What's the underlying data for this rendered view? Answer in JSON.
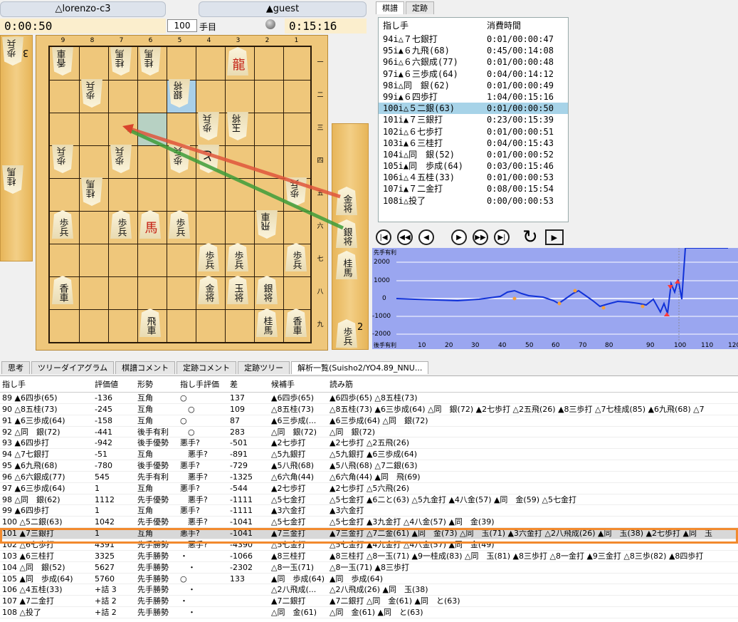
{
  "players": {
    "gote_name": "△lorenzo-c3",
    "sente_name": "▲guest",
    "gote_time": "0:00:50",
    "sente_time": "0:15:16",
    "move_number": "100",
    "move_unit": "手目"
  },
  "board": {
    "col_labels": [
      "9",
      "8",
      "7",
      "6",
      "5",
      "4",
      "3",
      "2",
      "1"
    ],
    "row_labels": [
      "一",
      "二",
      "三",
      "四",
      "五",
      "六",
      "七",
      "八",
      "九"
    ],
    "gote_hand_count": "3",
    "sente_hand_count": "2",
    "pieces": [
      {
        "t": "香車",
        "g": true
      },
      {
        "t": "桂馬",
        "g": true
      },
      {
        "t": "桂馬",
        "g": true
      },
      {
        "t": "龍",
        "g": false,
        "p": true
      },
      {
        "t": "歩兵",
        "g": true
      },
      {
        "t": "銀将",
        "g": true
      },
      {
        "t": "歩兵",
        "g": true
      },
      {
        "t": "玉将",
        "g": true
      },
      {
        "t": "歩兵",
        "g": true
      },
      {
        "t": "歩兵",
        "g": true
      },
      {
        "t": "歩兵",
        "g": true
      },
      {
        "t": "と",
        "g": true
      },
      {
        "t": "桂馬",
        "g": true
      },
      {
        "t": "歩兵",
        "g": true
      },
      {
        "t": "歩兵",
        "g": false
      },
      {
        "t": "歩兵",
        "g": false
      },
      {
        "t": "馬",
        "g": false,
        "p": true
      },
      {
        "t": "歩兵",
        "g": false
      },
      {
        "t": "飛車",
        "g": true
      },
      {
        "t": "歩兵",
        "g": false
      },
      {
        "t": "歩兵",
        "g": false
      },
      {
        "t": "歩兵",
        "g": false
      },
      {
        "t": "香車",
        "g": false
      },
      {
        "t": "金将",
        "g": false
      },
      {
        "t": "玉将",
        "g": false
      },
      {
        "t": "銀将",
        "g": false
      },
      {
        "t": "飛車",
        "g": false
      },
      {
        "t": "桂馬",
        "g": false
      },
      {
        "t": "香車",
        "g": false
      }
    ],
    "gote_hand": [
      {
        "t": "歩兵"
      },
      {
        "t": "桂馬"
      }
    ],
    "sente_hand": [
      {
        "t": "金将"
      },
      {
        "t": "銀将"
      },
      {
        "t": "桂馬"
      },
      {
        "t": "歩兵"
      }
    ]
  },
  "kifu_tabs": [
    "棋譜",
    "定跡"
  ],
  "kifu_header": {
    "move": "指し手",
    "time": "消費時間"
  },
  "kifu": [
    {
      "m": "94i△７七銀打",
      "t": "0:01/00:00:47"
    },
    {
      "m": "95i▲６九飛(68)",
      "t": "0:45/00:14:08"
    },
    {
      "m": "96i△６六銀成(77)",
      "t": "0:01/00:00:48"
    },
    {
      "m": "97i▲６三歩成(64)",
      "t": "0:04/00:14:12"
    },
    {
      "m": "98i△同　銀(62)",
      "t": "0:01/00:00:49"
    },
    {
      "m": "99i▲６四歩打",
      "t": "1:04/00:15:16"
    },
    {
      "m": "100i△５二銀(63)",
      "t": "0:01/00:00:50"
    },
    {
      "m": "101i▲７三銀打",
      "t": "0:23/00:15:39"
    },
    {
      "m": "102i△６七歩打",
      "t": "0:01/00:00:51"
    },
    {
      "m": "103i▲６三桂打",
      "t": "0:04/00:15:43"
    },
    {
      "m": "104i△同　銀(52)",
      "t": "0:01/00:00:52"
    },
    {
      "m": "105i▲同　歩成(64)",
      "t": "0:03/00:15:46"
    },
    {
      "m": "106i△４五桂(33)",
      "t": "0:01/00:00:53"
    },
    {
      "m": "107i▲７二金打",
      "t": "0:08/00:15:54"
    },
    {
      "m": "108i△投了",
      "t": "0:00/00:00:53"
    }
  ],
  "graph": {
    "title": "先手有利",
    "bottom_label": "後手有利",
    "y_ticks": [
      "2000",
      "1000",
      "0",
      "-1000",
      "-2000"
    ],
    "x_ticks": [
      "10",
      "20",
      "30",
      "40",
      "50",
      "60",
      "70",
      "80",
      "90",
      "100",
      "110",
      "120"
    ]
  },
  "lower_tabs": [
    "思考",
    "ツリーダイアグラム",
    "棋譜コメント",
    "定跡コメント",
    "定跡ツリー",
    "解析一覧(Suisho2/YO4.89_NNU..."
  ],
  "analysis_header": [
    "指し手",
    "評価値",
    "形勢",
    "指し手評価",
    "差",
    "候補手",
    "読み筋"
  ],
  "analysis": [
    [
      "89 ▲6四歩(65)",
      "-136",
      "互角",
      "○",
      "137",
      "▲6四歩(65)",
      "▲6四歩(65) △8五桂(73)"
    ],
    [
      "90 △8五桂(73)",
      "-245",
      "互角",
      "　○",
      "109",
      "△8五桂(73)",
      "△8五桂(73) ▲6三歩成(64) △同　銀(72) ▲2七歩打 △2五飛(26) ▲8三歩打 △7七桂成(85) ▲6九飛(68) △7"
    ],
    [
      "91 ▲6三歩成(64)",
      "-158",
      "互角",
      "○",
      "87",
      "▲6三歩成(...",
      "▲6三歩成(64) △同　銀(72)"
    ],
    [
      "92 △同　銀(72)",
      "-441",
      "後手有利",
      "　○",
      "283",
      "△同　銀(72)",
      "△同　銀(72)"
    ],
    [
      "93 ▲6四歩打",
      "-942",
      "後手優勢",
      "悪手?",
      "-501",
      "▲2七歩打",
      "▲2七歩打 △2五飛(26)"
    ],
    [
      "94 △7七銀打",
      "-51",
      "互角",
      "　悪手?",
      "-891",
      "△5九銀打",
      "△5九銀打 ▲6三歩成(64)"
    ],
    [
      "95 ▲6九飛(68)",
      "-780",
      "後手優勢",
      "悪手?",
      "-729",
      "▲5八飛(68)",
      "▲5八飛(68) △7二銀(63)"
    ],
    [
      "96 △6六銀成(77)",
      "545",
      "先手有利",
      "　悪手?",
      "-1325",
      "△6六角(44)",
      "△6六角(44) ▲同　飛(69)"
    ],
    [
      "97 ▲6三歩成(64)",
      "1",
      "互角",
      "悪手?",
      "-544",
      "▲2七歩打",
      "▲2七歩打 △5六飛(26)"
    ],
    [
      "98 △同　銀(62)",
      "1112",
      "先手優勢",
      "　悪手?",
      "-1111",
      "△5七金打",
      "△5七金打 ▲6二と(63) △5九金打 ▲4八金(57) ▲同　金(59) △5七金打"
    ],
    [
      "99 ▲6四歩打",
      "1",
      "互角",
      "悪手?",
      "-1111",
      "▲3六金打",
      "▲3六金打"
    ],
    [
      "100 △5二銀(63)",
      "1042",
      "先手優勢",
      "　悪手?",
      "-1041",
      "△5七金打",
      "△5七金打 ▲3九金打 △4八金(57) ▲同　金(39)"
    ],
    [
      "101 ▲7三銀打",
      "1",
      "互角",
      "悪手?",
      "-1041",
      "▲7三金打",
      "▲7三金打 △7二金(61) ▲同　金(73) △同　玉(71) ▲3六金打 △2八飛成(26) ▲同　玉(38) ▲2七歩打 ▲同　玉"
    ],
    [
      "102 △6七歩打",
      "4391",
      "先手勝勢",
      "　悪手?",
      "-4390",
      "△5七金打",
      "△5七金打 ▲4九金打 △4八金(57) ▲同　金(49)"
    ],
    [
      "103 ▲6三桂打",
      "3325",
      "先手勝勢",
      "・",
      "-1066",
      "▲8三桂打",
      "▲8三桂打 △8一玉(71) ▲9一桂成(83) △同　玉(81) ▲8三歩打 △8一金打 ▲9三金打 △8三歩(82) ▲8四歩打"
    ],
    [
      "104 △同　銀(52)",
      "5627",
      "先手勝勢",
      "　・",
      "-2302",
      "△8一玉(71)",
      "△8一玉(71) ▲8三歩打"
    ],
    [
      "105 ▲同　歩成(64)",
      "5760",
      "先手勝勢",
      "○",
      "133",
      "▲同　歩成(64)",
      "▲同　歩成(64)"
    ],
    [
      "106 △4五桂(33)",
      "+詰 3",
      "先手勝勢",
      "　・",
      "",
      "△2八飛成(...",
      "△2八飛成(26) ▲同　玉(38)"
    ],
    [
      "107 ▲7二金打",
      "+詰 2",
      "先手勝勢",
      "・",
      "",
      "▲7二銀打",
      "▲7二銀打 △同　金(61) ▲同　と(63)"
    ],
    [
      "108 △投了",
      "+詰 2",
      "先手勝勢",
      "　・",
      "",
      "△同　金(61)",
      "△同　金(61) ▲同　と(63)"
    ]
  ]
}
